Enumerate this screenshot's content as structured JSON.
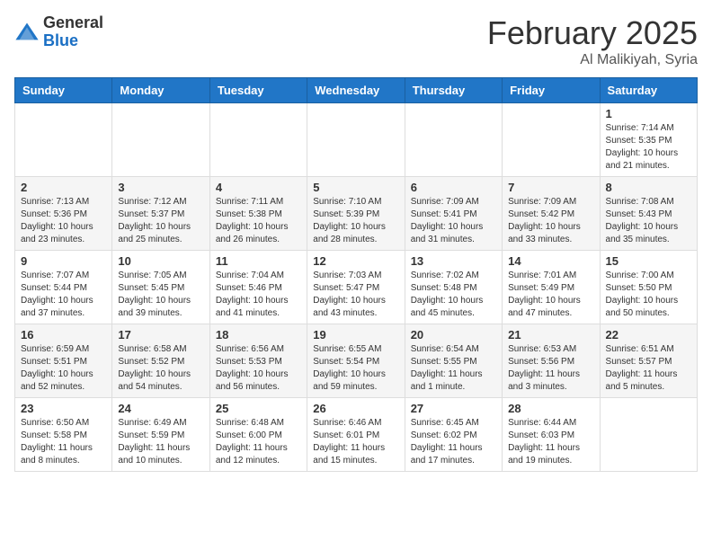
{
  "header": {
    "logo_general": "General",
    "logo_blue": "Blue",
    "month_title": "February 2025",
    "location": "Al Malikiyah, Syria"
  },
  "days_of_week": [
    "Sunday",
    "Monday",
    "Tuesday",
    "Wednesday",
    "Thursday",
    "Friday",
    "Saturday"
  ],
  "weeks": [
    [
      {
        "day": "",
        "info": ""
      },
      {
        "day": "",
        "info": ""
      },
      {
        "day": "",
        "info": ""
      },
      {
        "day": "",
        "info": ""
      },
      {
        "day": "",
        "info": ""
      },
      {
        "day": "",
        "info": ""
      },
      {
        "day": "1",
        "info": "Sunrise: 7:14 AM\nSunset: 5:35 PM\nDaylight: 10 hours and 21 minutes."
      }
    ],
    [
      {
        "day": "2",
        "info": "Sunrise: 7:13 AM\nSunset: 5:36 PM\nDaylight: 10 hours and 23 minutes."
      },
      {
        "day": "3",
        "info": "Sunrise: 7:12 AM\nSunset: 5:37 PM\nDaylight: 10 hours and 25 minutes."
      },
      {
        "day": "4",
        "info": "Sunrise: 7:11 AM\nSunset: 5:38 PM\nDaylight: 10 hours and 26 minutes."
      },
      {
        "day": "5",
        "info": "Sunrise: 7:10 AM\nSunset: 5:39 PM\nDaylight: 10 hours and 28 minutes."
      },
      {
        "day": "6",
        "info": "Sunrise: 7:09 AM\nSunset: 5:41 PM\nDaylight: 10 hours and 31 minutes."
      },
      {
        "day": "7",
        "info": "Sunrise: 7:09 AM\nSunset: 5:42 PM\nDaylight: 10 hours and 33 minutes."
      },
      {
        "day": "8",
        "info": "Sunrise: 7:08 AM\nSunset: 5:43 PM\nDaylight: 10 hours and 35 minutes."
      }
    ],
    [
      {
        "day": "9",
        "info": "Sunrise: 7:07 AM\nSunset: 5:44 PM\nDaylight: 10 hours and 37 minutes."
      },
      {
        "day": "10",
        "info": "Sunrise: 7:05 AM\nSunset: 5:45 PM\nDaylight: 10 hours and 39 minutes."
      },
      {
        "day": "11",
        "info": "Sunrise: 7:04 AM\nSunset: 5:46 PM\nDaylight: 10 hours and 41 minutes."
      },
      {
        "day": "12",
        "info": "Sunrise: 7:03 AM\nSunset: 5:47 PM\nDaylight: 10 hours and 43 minutes."
      },
      {
        "day": "13",
        "info": "Sunrise: 7:02 AM\nSunset: 5:48 PM\nDaylight: 10 hours and 45 minutes."
      },
      {
        "day": "14",
        "info": "Sunrise: 7:01 AM\nSunset: 5:49 PM\nDaylight: 10 hours and 47 minutes."
      },
      {
        "day": "15",
        "info": "Sunrise: 7:00 AM\nSunset: 5:50 PM\nDaylight: 10 hours and 50 minutes."
      }
    ],
    [
      {
        "day": "16",
        "info": "Sunrise: 6:59 AM\nSunset: 5:51 PM\nDaylight: 10 hours and 52 minutes."
      },
      {
        "day": "17",
        "info": "Sunrise: 6:58 AM\nSunset: 5:52 PM\nDaylight: 10 hours and 54 minutes."
      },
      {
        "day": "18",
        "info": "Sunrise: 6:56 AM\nSunset: 5:53 PM\nDaylight: 10 hours and 56 minutes."
      },
      {
        "day": "19",
        "info": "Sunrise: 6:55 AM\nSunset: 5:54 PM\nDaylight: 10 hours and 59 minutes."
      },
      {
        "day": "20",
        "info": "Sunrise: 6:54 AM\nSunset: 5:55 PM\nDaylight: 11 hours and 1 minute."
      },
      {
        "day": "21",
        "info": "Sunrise: 6:53 AM\nSunset: 5:56 PM\nDaylight: 11 hours and 3 minutes."
      },
      {
        "day": "22",
        "info": "Sunrise: 6:51 AM\nSunset: 5:57 PM\nDaylight: 11 hours and 5 minutes."
      }
    ],
    [
      {
        "day": "23",
        "info": "Sunrise: 6:50 AM\nSunset: 5:58 PM\nDaylight: 11 hours and 8 minutes."
      },
      {
        "day": "24",
        "info": "Sunrise: 6:49 AM\nSunset: 5:59 PM\nDaylight: 11 hours and 10 minutes."
      },
      {
        "day": "25",
        "info": "Sunrise: 6:48 AM\nSunset: 6:00 PM\nDaylight: 11 hours and 12 minutes."
      },
      {
        "day": "26",
        "info": "Sunrise: 6:46 AM\nSunset: 6:01 PM\nDaylight: 11 hours and 15 minutes."
      },
      {
        "day": "27",
        "info": "Sunrise: 6:45 AM\nSunset: 6:02 PM\nDaylight: 11 hours and 17 minutes."
      },
      {
        "day": "28",
        "info": "Sunrise: 6:44 AM\nSunset: 6:03 PM\nDaylight: 11 hours and 19 minutes."
      },
      {
        "day": "",
        "info": ""
      }
    ]
  ]
}
